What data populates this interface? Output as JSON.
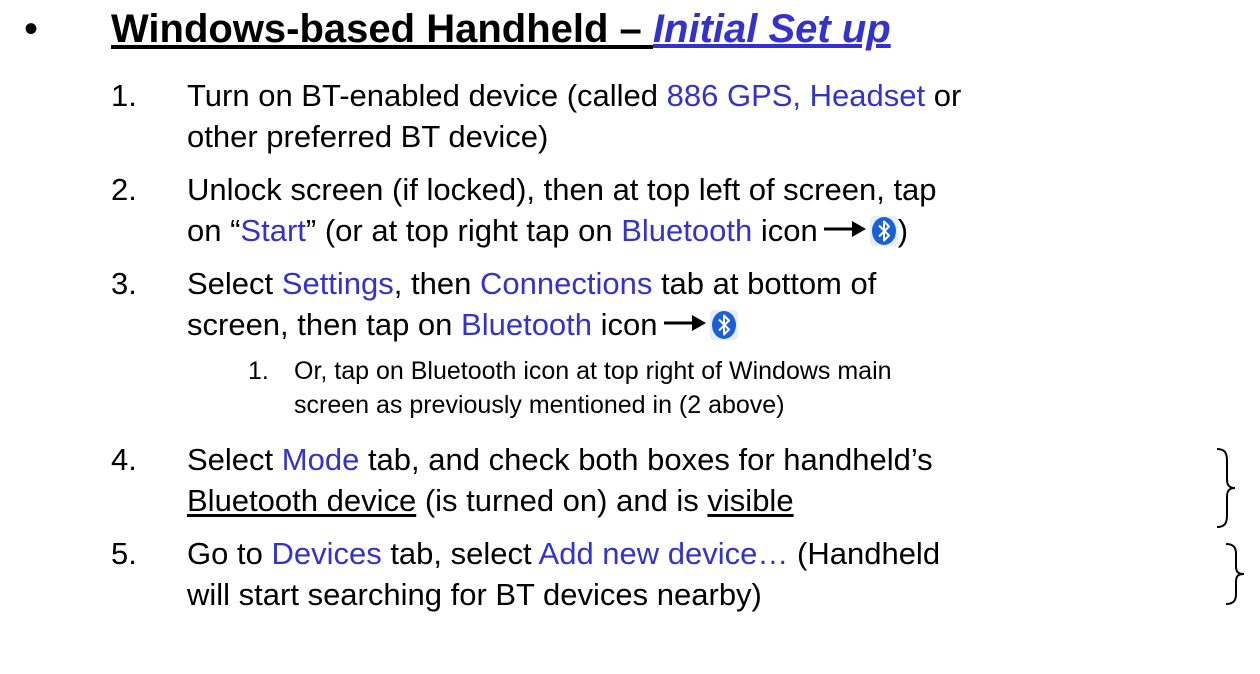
{
  "header": {
    "bullet": "•",
    "title_main": "Windows-based Handheld – ",
    "title_link": "Initial Set up"
  },
  "steps": [
    {
      "number": "1.",
      "line1": {
        "a": "Turn on BT-enabled device (called ",
        "b": "886 GPS, Headset",
        "c": " or"
      },
      "line2": "other preferred BT device)"
    },
    {
      "number": "2.",
      "line1": "Unlock screen (if locked), then at top left of screen, tap",
      "line2": {
        "a": "on “",
        "b": "Start",
        "c": "”",
        "d": " (or at top right tap on ",
        "e": "Bluetooth",
        "f": " icon",
        "g": ")"
      }
    },
    {
      "number": "3.",
      "line1": {
        "a": "Select ",
        "b": "Settings",
        "c": ", then ",
        "d": "Connections",
        "e": " tab at bottom of"
      },
      "line2": {
        "a": "screen, then tap on ",
        "b": "Bluetooth",
        "c": " icon"
      },
      "sub": {
        "number": "1.",
        "line1": "Or, tap on Bluetooth icon at top right of Windows main",
        "line2": "screen as previously mentioned in (2 above)"
      }
    },
    {
      "number": "4.",
      "line1": {
        "a": "Select ",
        "b": "Mode",
        "c": " tab, and check both boxes for handheld’s"
      },
      "line2": {
        "a": "Bluetooth device",
        "b": " (is turned on) and is ",
        "c": "visible"
      }
    },
    {
      "number": "5.",
      "line1": {
        "a": "Go to ",
        "b": "Devices",
        "c": " tab, select ",
        "d": "Add new device…",
        "e": " (Handheld"
      },
      "line2": "will start searching for BT devices nearby)"
    }
  ],
  "icons": {
    "bluetooth": "bluetooth-icon",
    "arrow": "right-arrow-icon",
    "brace": "right-brace-icon"
  },
  "colors": {
    "accent_blue": "#3333cc",
    "bluetooth_blue": "#1a5fd6",
    "text": "#000000",
    "background": "#ffffff"
  }
}
